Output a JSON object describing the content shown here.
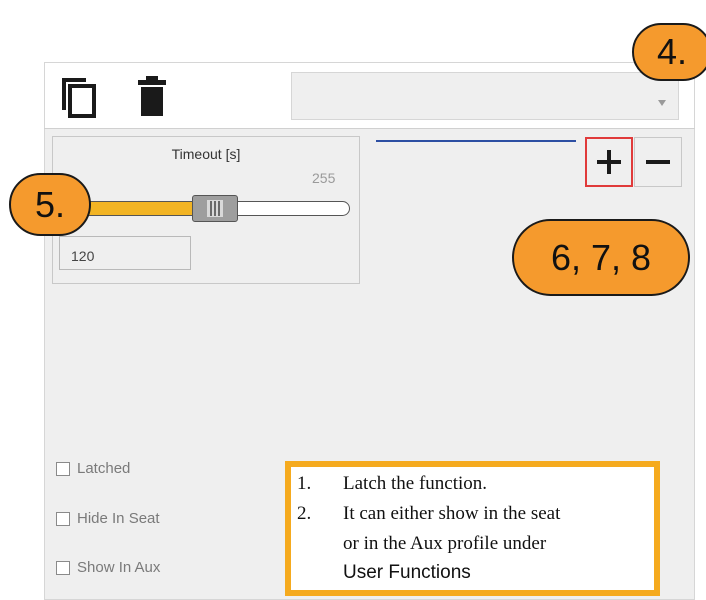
{
  "toolbar": {
    "copy_icon": "copy-icon",
    "delete_icon": "trash-icon",
    "dropdown_value": ""
  },
  "slider": {
    "title": "Timeout  [s]",
    "max_label": "255",
    "value": 120,
    "max": 255,
    "value_text": "120"
  },
  "buttons": {
    "add_label": "+",
    "remove_label": "−"
  },
  "callouts": {
    "c4": "4.",
    "c5": "5.",
    "c678": "6, 7, 8"
  },
  "checkboxes": [
    {
      "label": "Latched",
      "checked": false
    },
    {
      "label": "Hide In Seat",
      "checked": false
    },
    {
      "label": "Show In Aux",
      "checked": false
    }
  ],
  "note": {
    "items": [
      {
        "num": "1.",
        "text": "Latch the function."
      },
      {
        "num": "2.",
        "text": "It can either show in the seat"
      }
    ],
    "line3": "or in the Aux profile under",
    "line4": "User Functions"
  },
  "colors": {
    "accent_orange": "#f59a2d",
    "slider_fill": "#f2b424",
    "blue_line": "#2d4fa3",
    "plus_border": "#e03a3a"
  }
}
